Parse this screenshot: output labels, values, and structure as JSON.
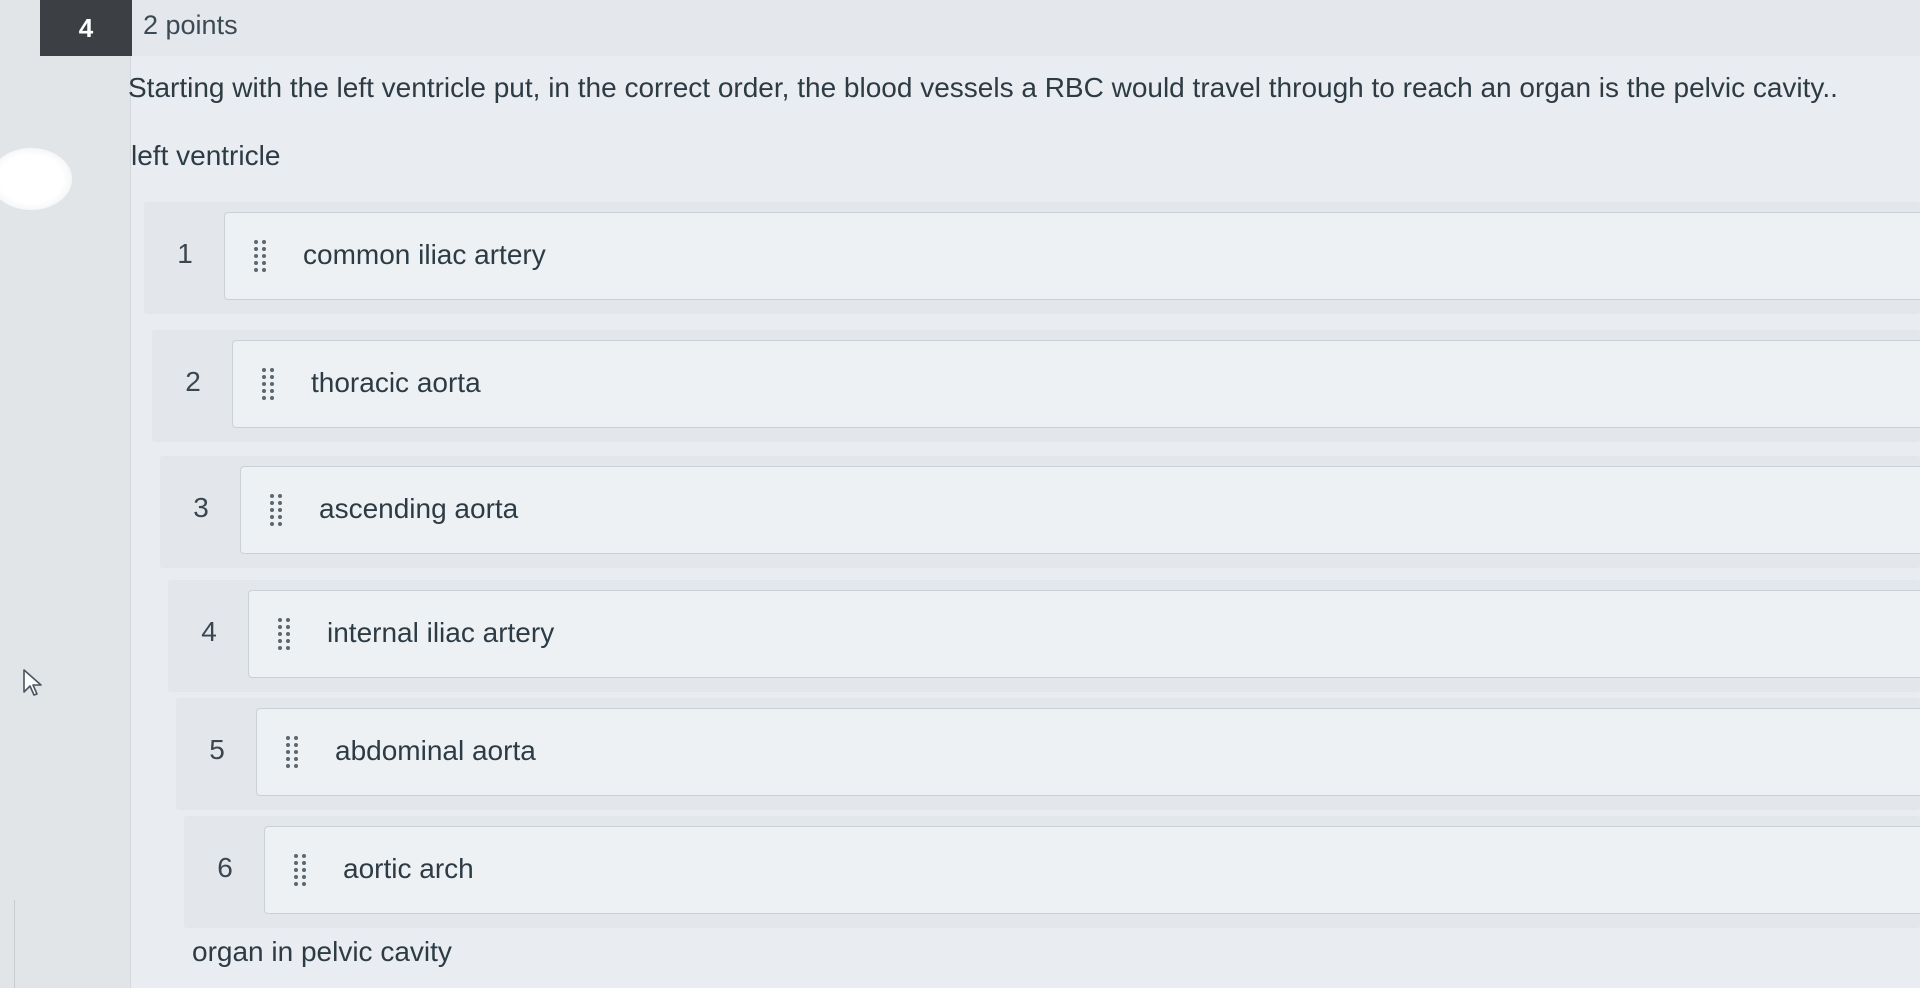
{
  "question": {
    "number": "4",
    "points": "2 points",
    "text": "Starting with the left ventricle put, in the correct order, the blood vessels a RBC would travel through to reach an organ is the pelvic cavity..",
    "top_anchor": "left ventricle",
    "bottom_anchor": "organ in pelvic cavity"
  },
  "ordering_items": [
    {
      "rank": "1",
      "label": "common iliac artery",
      "grip_icon": "drag-handle-icon"
    },
    {
      "rank": "2",
      "label": "thoracic aorta",
      "grip_icon": "drag-handle-icon"
    },
    {
      "rank": "3",
      "label": "ascending aorta",
      "grip_icon": "drag-handle-icon"
    },
    {
      "rank": "4",
      "label": "internal iliac artery",
      "grip_icon": "drag-handle-icon"
    },
    {
      "rank": "5",
      "label": "abdominal aorta",
      "grip_icon": "drag-handle-icon"
    },
    {
      "rank": "6",
      "label": "aortic arch",
      "grip_icon": "drag-handle-icon"
    }
  ],
  "colors": {
    "badge_background": "#3c4044",
    "page_background": "#e9edf1",
    "item_background": "#edf1f4",
    "text": "#2d3b45"
  }
}
